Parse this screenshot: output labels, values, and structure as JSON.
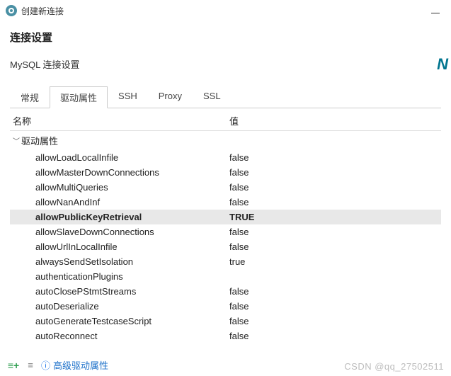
{
  "window": {
    "title": "创建新连接"
  },
  "page": {
    "heading": "连接设置",
    "subheading": "MySQL 连接设置",
    "brand_fragment": "N"
  },
  "tabs": {
    "items": [
      {
        "label": "常规"
      },
      {
        "label": "驱动属性"
      },
      {
        "label": "SSH"
      },
      {
        "label": "Proxy"
      },
      {
        "label": "SSL"
      }
    ],
    "active_index": 1
  },
  "columns": {
    "name": "名称",
    "value": "值"
  },
  "tree": {
    "group_label": "驱动属性",
    "rows": [
      {
        "name": "allowLoadLocalInfile",
        "value": "false",
        "selected": false
      },
      {
        "name": "allowMasterDownConnections",
        "value": "false",
        "selected": false
      },
      {
        "name": "allowMultiQueries",
        "value": "false",
        "selected": false
      },
      {
        "name": "allowNanAndInf",
        "value": "false",
        "selected": false
      },
      {
        "name": "allowPublicKeyRetrieval",
        "value": "TRUE",
        "selected": true
      },
      {
        "name": "allowSlaveDownConnections",
        "value": "false",
        "selected": false
      },
      {
        "name": "allowUrlInLocalInfile",
        "value": "false",
        "selected": false
      },
      {
        "name": "alwaysSendSetIsolation",
        "value": "true",
        "selected": false
      },
      {
        "name": "authenticationPlugins",
        "value": "",
        "selected": false
      },
      {
        "name": "autoClosePStmtStreams",
        "value": "false",
        "selected": false
      },
      {
        "name": "autoDeserialize",
        "value": "false",
        "selected": false
      },
      {
        "name": "autoGenerateTestcaseScript",
        "value": "false",
        "selected": false
      },
      {
        "name": "autoReconnect",
        "value": "false",
        "selected": false
      }
    ]
  },
  "footer": {
    "link_text": "高级驱动属性"
  },
  "watermark": "CSDN @qq_27502511"
}
